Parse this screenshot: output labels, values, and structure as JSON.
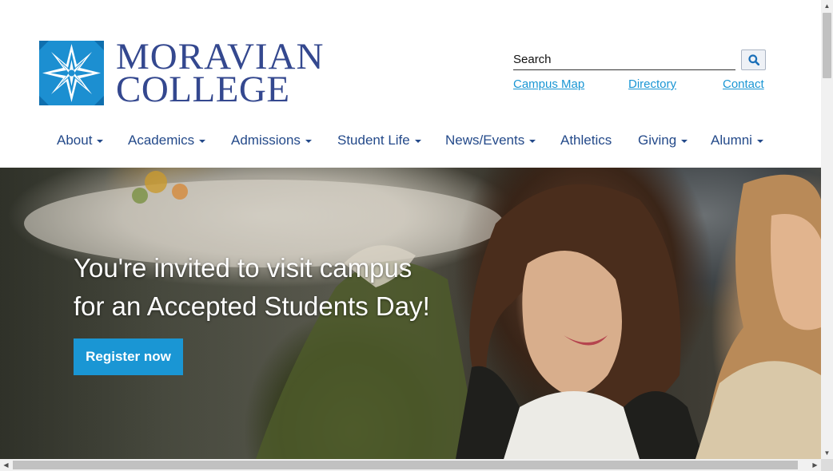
{
  "header": {
    "logo_line1": "MORAVIAN",
    "logo_line2": "COLLEGE",
    "brand_color": "#34488f",
    "search": {
      "placeholder": "Search",
      "button_icon": "search-icon"
    },
    "utility_links": [
      "Campus Map",
      "Directory",
      "Contact"
    ],
    "link_color": "#1a96d4"
  },
  "nav": {
    "items": [
      {
        "label": "About",
        "dropdown": true
      },
      {
        "label": "Academics",
        "dropdown": true
      },
      {
        "label": "Admissions",
        "dropdown": true
      },
      {
        "label": "Student Life",
        "dropdown": true
      },
      {
        "label": "News/Events",
        "dropdown": true
      },
      {
        "label": "Athletics",
        "dropdown": false
      },
      {
        "label": "Giving",
        "dropdown": true
      },
      {
        "label": "Alumni",
        "dropdown": true
      }
    ],
    "color": "#244a8a"
  },
  "hero": {
    "headline_line1": "You're invited to visit campus",
    "headline_line2": "for an Accepted Students Day!",
    "cta_label": "Register now",
    "cta_color": "#1a96d4"
  }
}
